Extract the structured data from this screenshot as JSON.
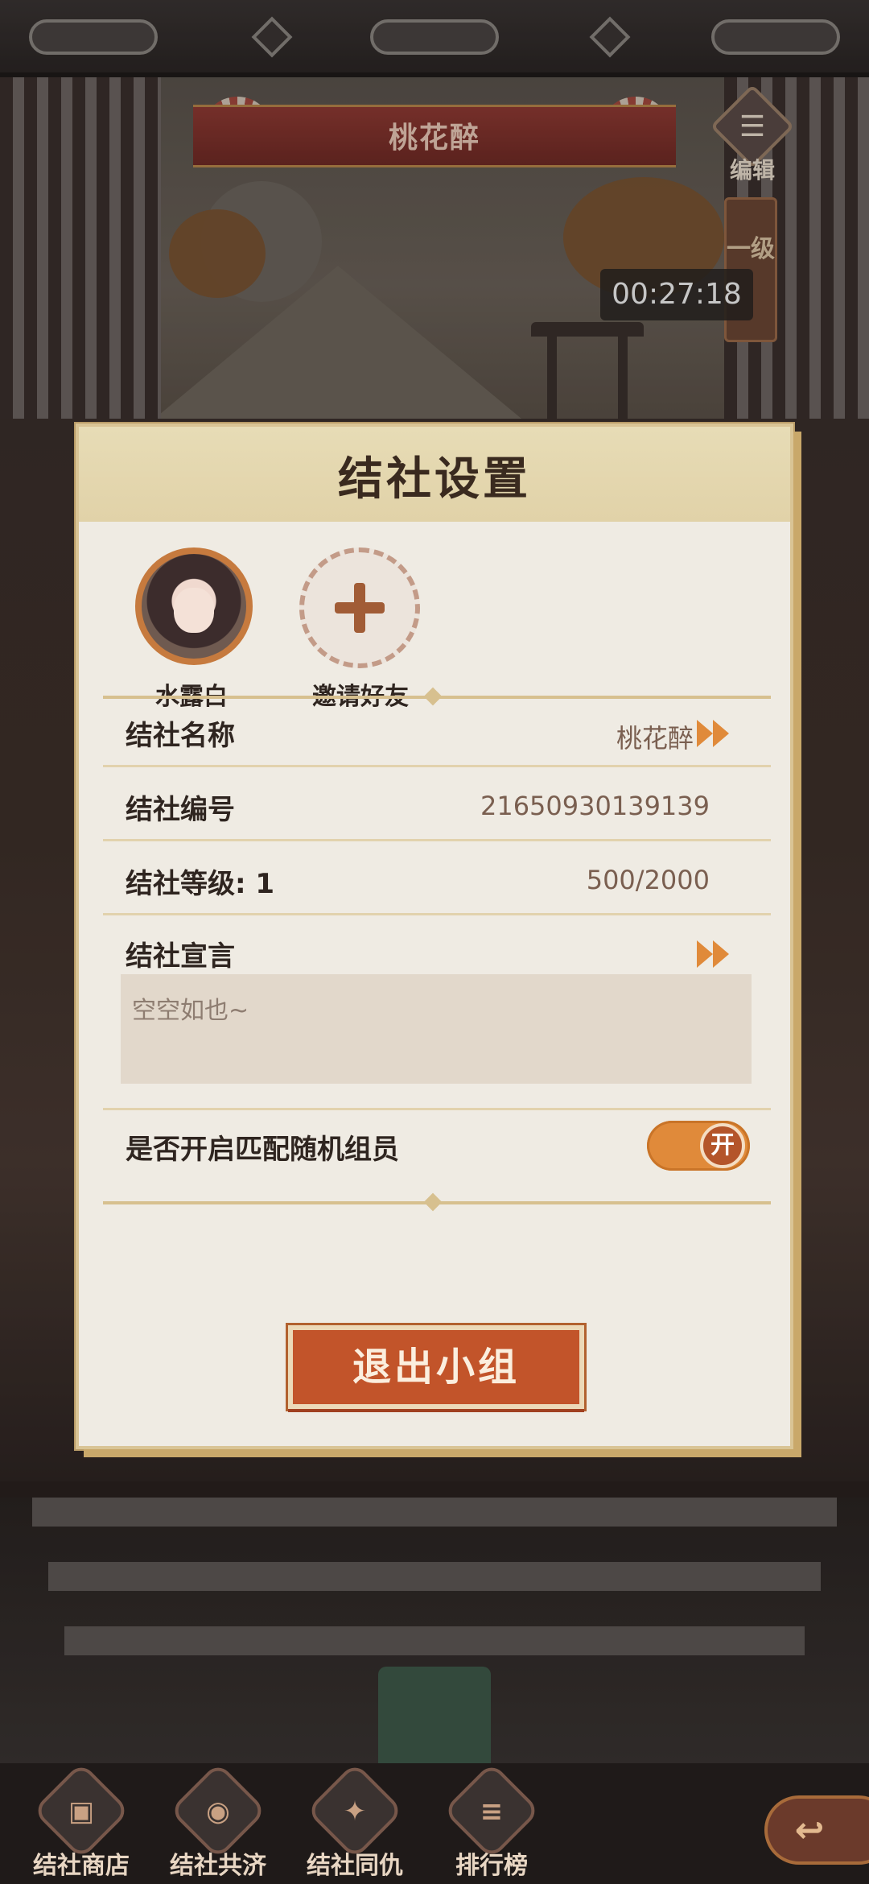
{
  "header": {
    "banner_title": "桃花醉",
    "edit_glyph": "☰",
    "edit_label": "编辑",
    "tag_text": "一级",
    "timer": "00:27:18"
  },
  "modal": {
    "title": "结社设置",
    "members": [
      {
        "name": "水露白"
      },
      {
        "name": "邀请好友"
      }
    ],
    "rows": {
      "name_label": "结社名称",
      "name_value": "桃花醉",
      "id_label": "结社编号",
      "id_value": "21650930139139",
      "level_label": "结社等级: 1",
      "level_value": "500/2000",
      "manifesto_label": "结社宣言",
      "manifesto_text": "空空如也~",
      "match_label": "是否开启匹配随机组员",
      "match_toggle": "开"
    },
    "quit_label": "退出小组"
  },
  "bottom_nav": {
    "items": [
      {
        "glyph": "▣",
        "label": "结社商店"
      },
      {
        "glyph": "◉",
        "label": "结社共济"
      },
      {
        "glyph": "✦",
        "label": "结社同仇"
      },
      {
        "glyph": "≡",
        "label": "排行榜"
      }
    ],
    "back_glyph": "↩"
  },
  "colors": {
    "accent": "#e08a3a",
    "button": "#c2542a",
    "banner": "#8f3a33"
  }
}
